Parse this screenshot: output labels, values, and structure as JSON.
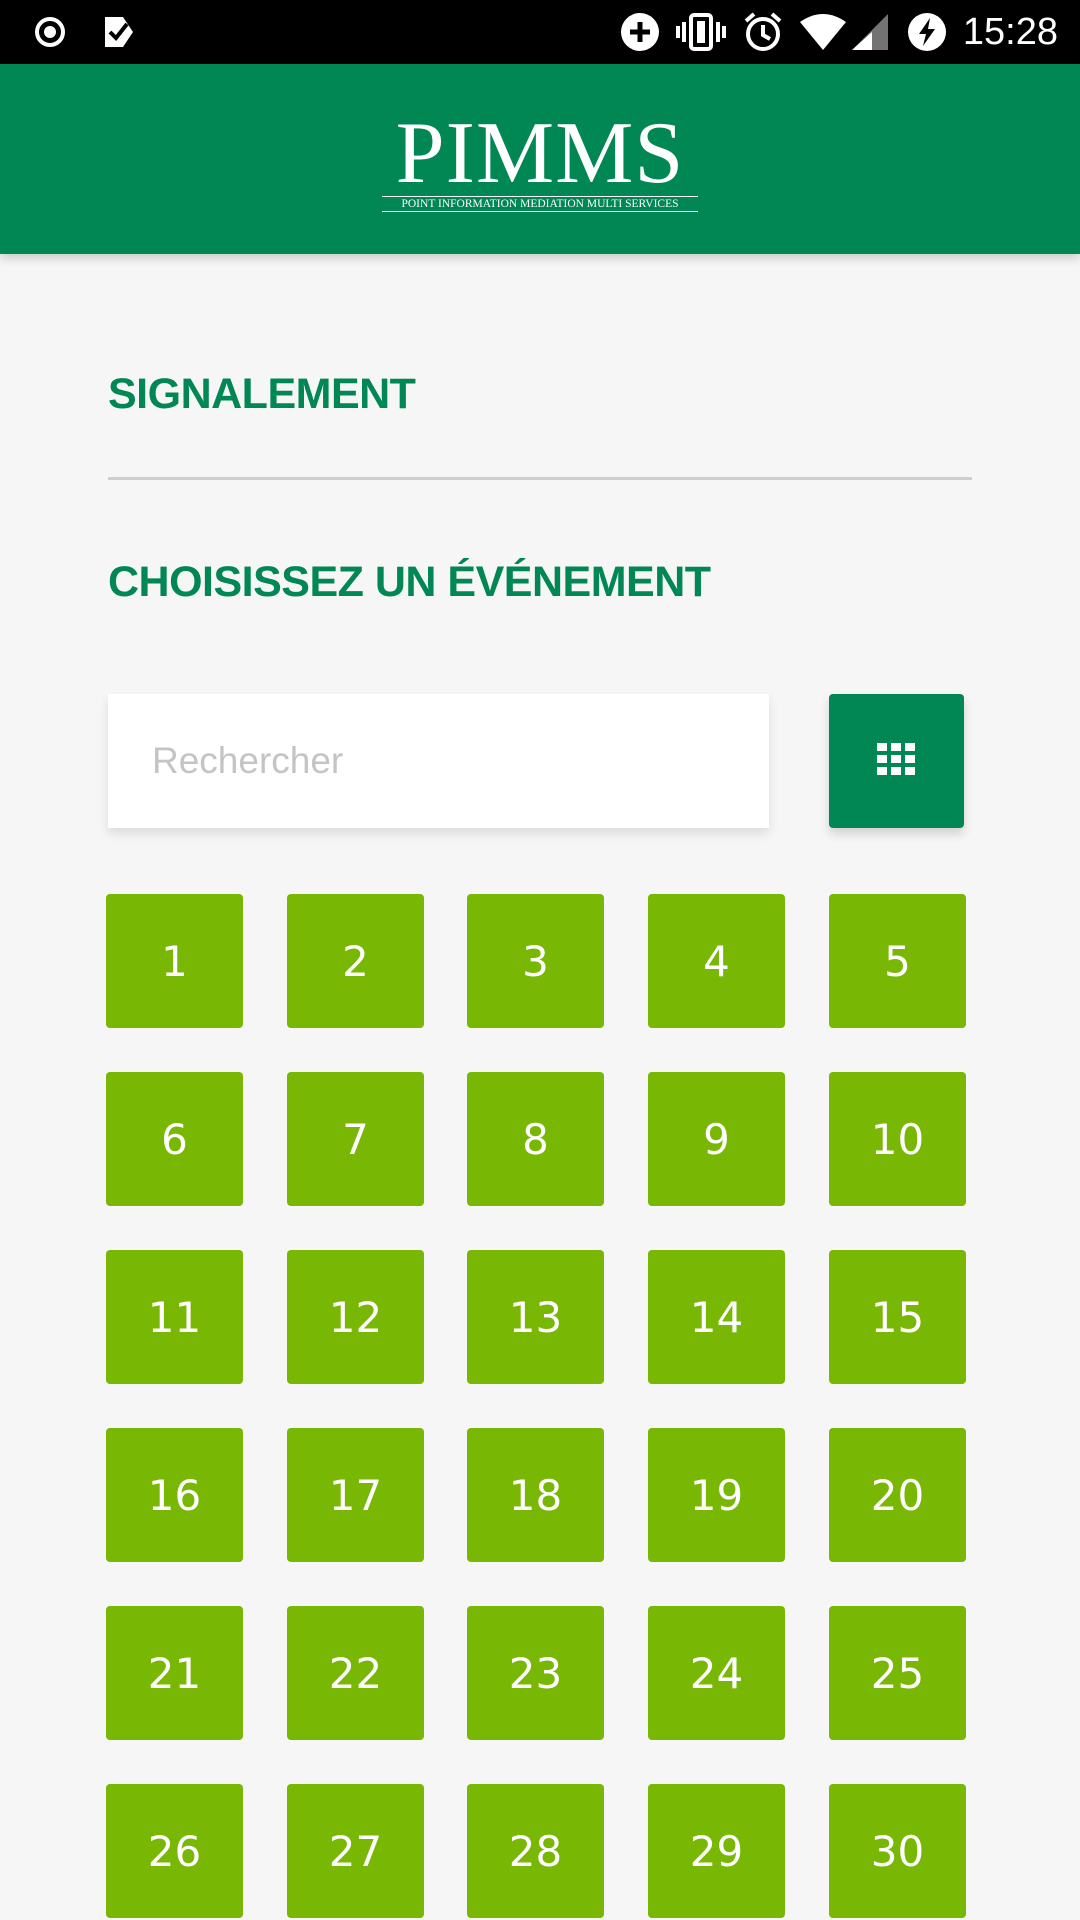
{
  "status_bar": {
    "time": "15:28",
    "icons": [
      "radio-button-icon",
      "check-tag-icon",
      "add-circle-icon",
      "vibrate-icon",
      "alarm-icon",
      "wifi-icon",
      "signal-icon",
      "battery-charging-icon"
    ]
  },
  "header": {
    "logo_word": "PIMMS",
    "logo_subtitle": "POINT INFORMATION MEDIATION MULTI SERVICES",
    "background": "#008754"
  },
  "main": {
    "section_title": "SIGNALEMENT",
    "subtitle": "CHOISISSEZ UN ÉVÉNEMENT",
    "search_placeholder": "Rechercher",
    "view_toggle_icon": "grid-view-icon",
    "tiles": [
      "1",
      "2",
      "3",
      "4",
      "5",
      "6",
      "7",
      "8",
      "9",
      "10",
      "11",
      "12",
      "13",
      "14",
      "15",
      "16",
      "17",
      "18",
      "19",
      "20",
      "21",
      "22",
      "23",
      "24",
      "25",
      "26",
      "27",
      "28",
      "29",
      "30"
    ]
  },
  "colors": {
    "brand_green": "#008754",
    "tile_green": "#78b704",
    "background": "#f6f6f6"
  }
}
